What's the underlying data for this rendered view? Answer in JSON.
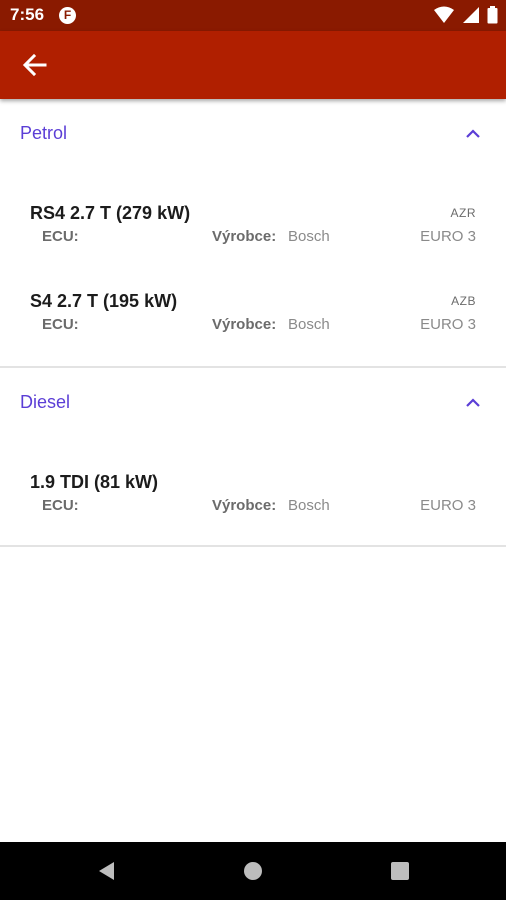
{
  "status_bar": {
    "time": "7:56",
    "app_icon_letter": "F"
  },
  "app_bar": {
    "back_icon": "arrow-back-icon"
  },
  "sections": [
    {
      "title": "Petrol",
      "expanded": true,
      "engines": [
        {
          "name": "RS4 2.7 T (279 kW)",
          "code": "AZR",
          "ecu_label": "ECU:",
          "maker_label": "Výrobce:",
          "maker": "Bosch",
          "emission": "EURO 3"
        },
        {
          "name": "S4 2.7 T (195 kW)",
          "code": "AZB",
          "ecu_label": "ECU:",
          "maker_label": "Výrobce:",
          "maker": "Bosch",
          "emission": "EURO 3"
        }
      ]
    },
    {
      "title": "Diesel",
      "expanded": true,
      "engines": [
        {
          "name": "1.9 TDI (81 kW)",
          "code": "",
          "ecu_label": "ECU:",
          "maker_label": "Výrobce:",
          "maker": "Bosch",
          "emission": "EURO 3"
        }
      ]
    }
  ],
  "colors": {
    "status_bar": "#8a1a00",
    "app_bar": "#b01f00",
    "section_title": "#5b3ed6"
  },
  "nav_bar": {
    "icons": [
      "back-triangle-icon",
      "home-circle-icon",
      "recents-square-icon"
    ]
  }
}
